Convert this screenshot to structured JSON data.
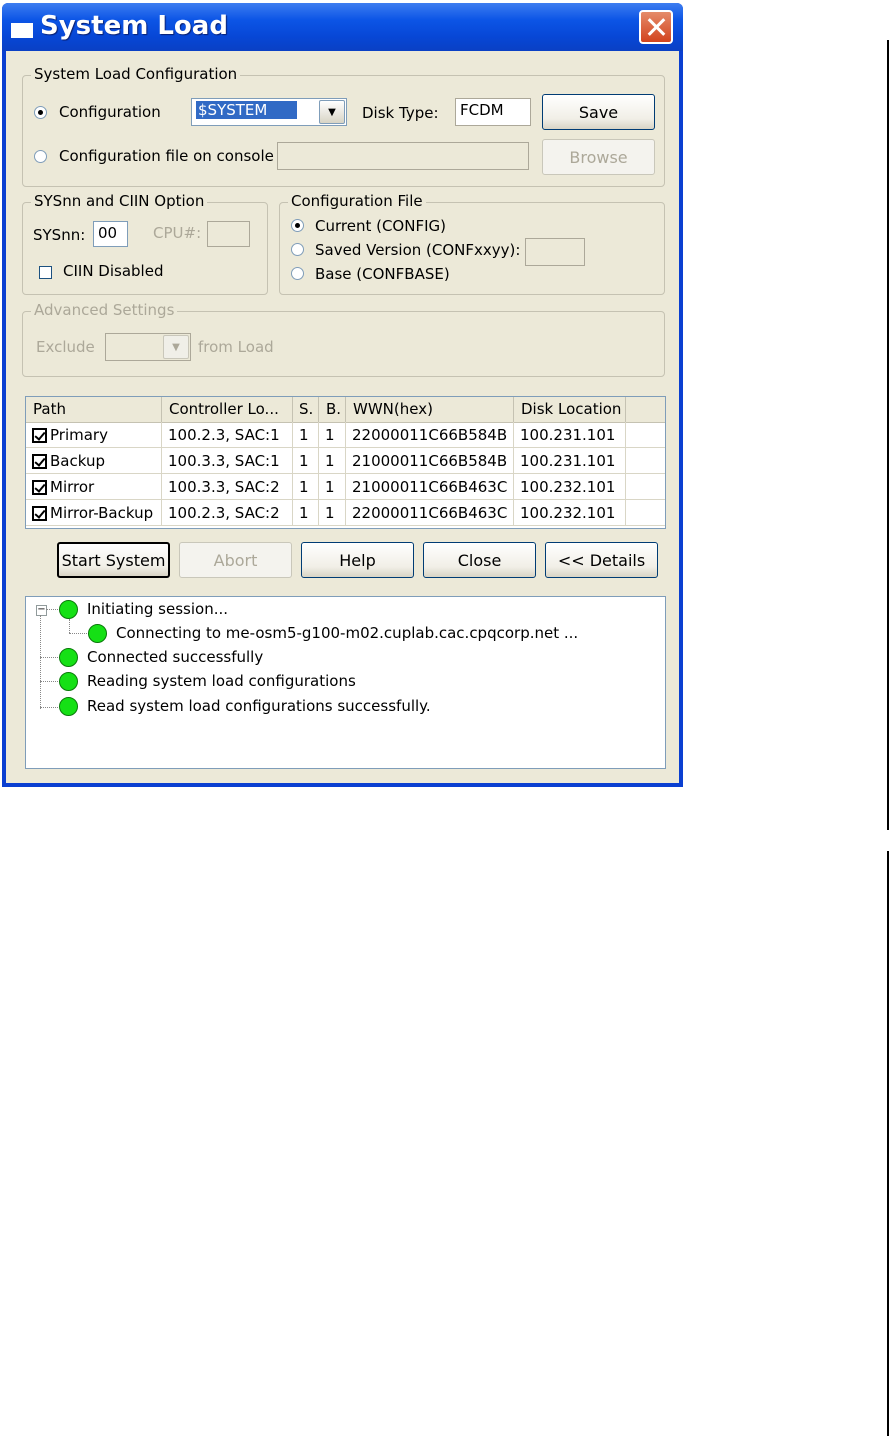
{
  "window": {
    "title": "System Load"
  },
  "config_group": {
    "legend": "System Load Configuration",
    "radio_config_label": "Configuration",
    "config_select_value": "$SYSTEM",
    "disk_type_label": "Disk Type:",
    "disk_type_value": "FCDM",
    "save_label": "Save",
    "radio_file_label": "Configuration file on console",
    "file_value": "",
    "browse_label": "Browse"
  },
  "sysnn_group": {
    "legend": "SYSnn and CIIN Option",
    "sysnn_label": "SYSnn:",
    "sysnn_value": "00",
    "cpu_label": "CPU#:",
    "cpu_value": "",
    "ciin_label": "CIIN Disabled"
  },
  "config_file_group": {
    "legend": "Configuration File",
    "current_label": "Current (CONFIG)",
    "saved_label": "Saved Version (CONFxxyy):",
    "saved_value": "",
    "base_label": "Base (CONFBASE)"
  },
  "advanced_group": {
    "legend": "Advanced Settings",
    "exclude_label": "Exclude",
    "exclude_value": "",
    "from_load_label": "from Load"
  },
  "paths_table": {
    "headers": [
      "Path",
      "Controller Lo...",
      "S.",
      "B.",
      "WWN(hex)",
      "Disk Location"
    ],
    "rows": [
      {
        "path": "Primary",
        "controller": "100.2.3, SAC:1",
        "s": "1",
        "b": "1",
        "wwn": "22000011C66B584B",
        "disk": "100.231.101"
      },
      {
        "path": "Backup",
        "controller": "100.3.3, SAC:1",
        "s": "1",
        "b": "1",
        "wwn": "21000011C66B584B",
        "disk": "100.231.101"
      },
      {
        "path": "Mirror",
        "controller": "100.3.3, SAC:2",
        "s": "1",
        "b": "1",
        "wwn": "21000011C66B463C",
        "disk": "100.232.101"
      },
      {
        "path": "Mirror-Backup",
        "controller": "100.2.3, SAC:2",
        "s": "1",
        "b": "1",
        "wwn": "22000011C66B463C",
        "disk": "100.232.101"
      }
    ]
  },
  "buttons": {
    "start": "Start System",
    "abort": "Abort",
    "help": "Help",
    "close": "Close",
    "details": "<< Details"
  },
  "log": {
    "items": [
      "Initiating session...",
      "Connecting to me-osm5-g100-m02.cuplab.cac.cpqcorp.net ...",
      "Connected successfully",
      "Reading system load configurations",
      "Read system load configurations successfully."
    ],
    "status_color": "#15e015"
  }
}
